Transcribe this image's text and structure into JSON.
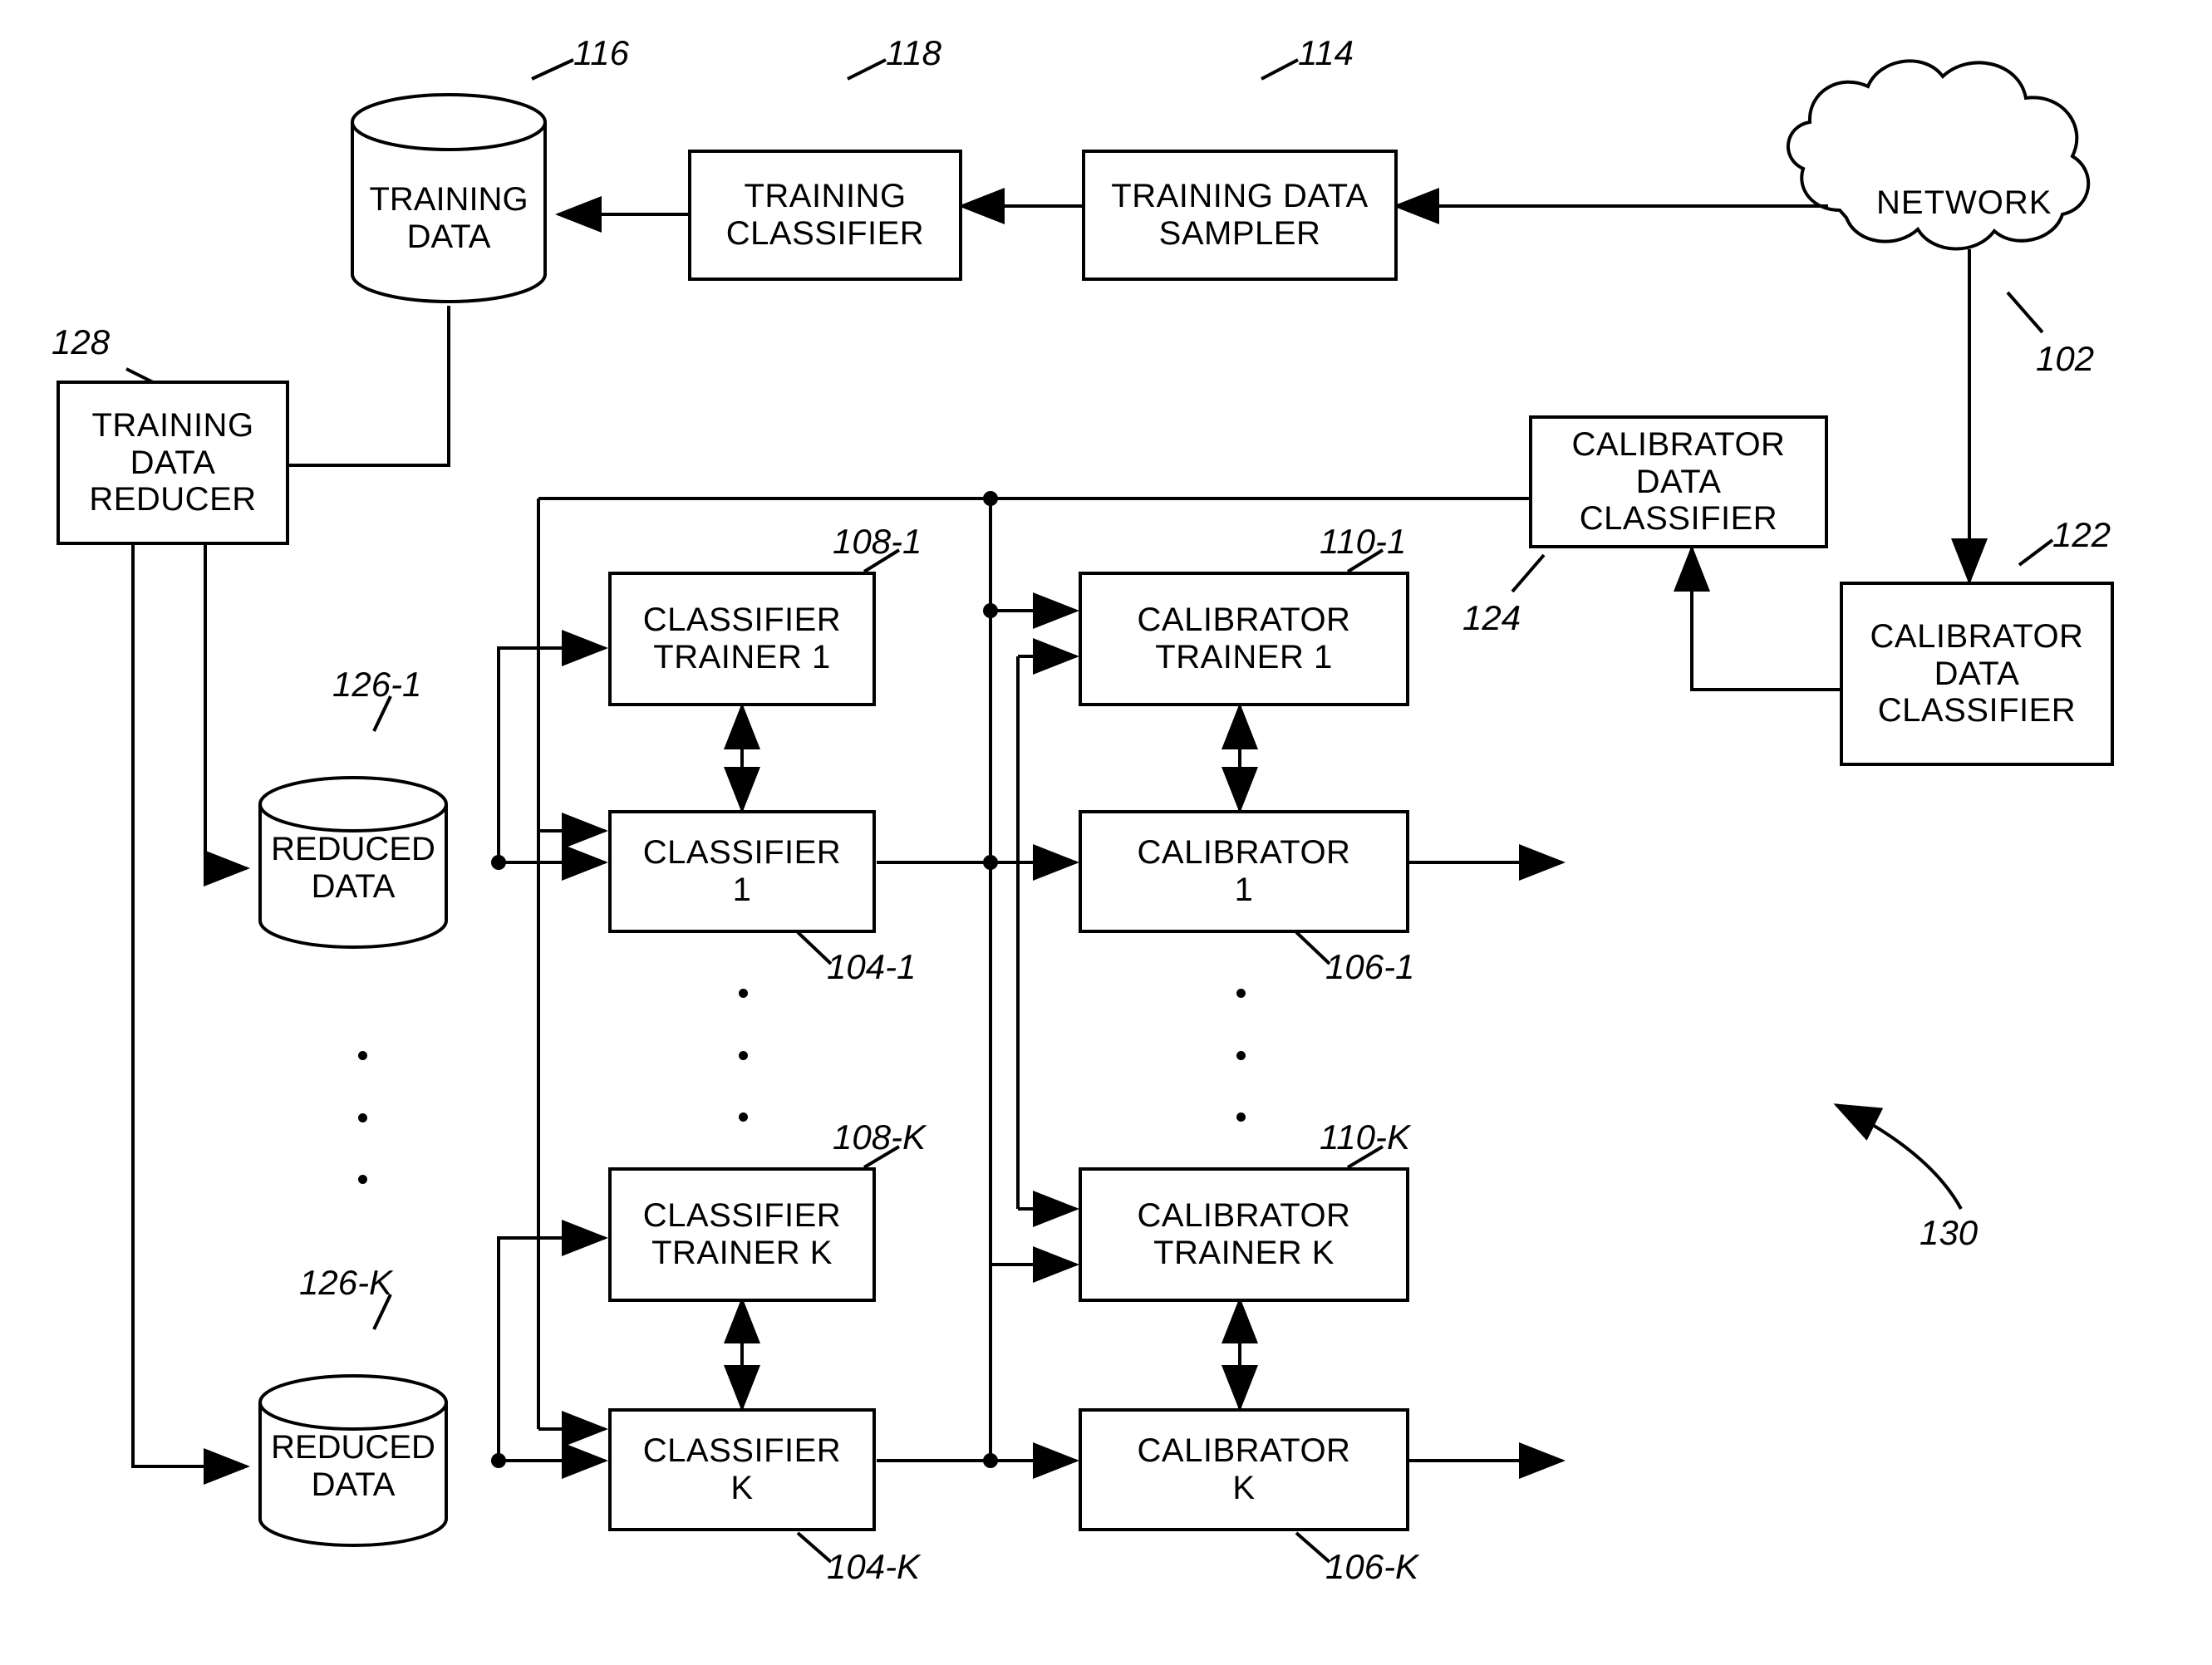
{
  "figure": {
    "title": "Classifier and calibrator training block diagram",
    "overall_ref": "130"
  },
  "nodes": {
    "training_data_store": {
      "lines": [
        "TRAINING",
        "DATA"
      ],
      "ref": "116"
    },
    "training_classifier": {
      "lines": [
        "TRAINING",
        "CLASSIFIER"
      ],
      "ref": "118"
    },
    "training_data_sampler": {
      "lines": [
        "TRAINING  DATA",
        "SAMPLER"
      ],
      "ref": "114"
    },
    "network": {
      "lines": [
        "NETWORK"
      ],
      "ref": "102"
    },
    "training_data_reducer": {
      "lines": [
        "TRAINING",
        "DATA",
        "REDUCER"
      ],
      "ref": "128"
    },
    "calibrator_data_classifier_top": {
      "lines": [
        "CALIBRATOR",
        "DATA",
        "CLASSIFIER"
      ],
      "ref": "124"
    },
    "calibrator_data_classifier_right": {
      "lines": [
        "CALIBRATOR",
        "DATA",
        "CLASSIFIER"
      ],
      "ref": "122"
    },
    "reduced_data_1": {
      "lines": [
        "REDUCED",
        "DATA"
      ],
      "ref": "126-1"
    },
    "reduced_data_k": {
      "lines": [
        "REDUCED",
        "DATA"
      ],
      "ref": "126-K"
    },
    "classifier_trainer_1": {
      "lines": [
        "CLASSIFIER",
        "TRAINER 1"
      ],
      "ref": "108-1"
    },
    "classifier_trainer_k": {
      "lines": [
        "CLASSIFIER",
        "TRAINER K"
      ],
      "ref": "108-K"
    },
    "classifier_1": {
      "lines": [
        "CLASSIFIER",
        "1"
      ],
      "ref": "104-1"
    },
    "classifier_k": {
      "lines": [
        "CLASSIFIER",
        "K"
      ],
      "ref": "104-K"
    },
    "calibrator_trainer_1": {
      "lines": [
        "CALIBRATOR",
        "TRAINER 1"
      ],
      "ref": "110-1"
    },
    "calibrator_trainer_k": {
      "lines": [
        "CALIBRATOR",
        "TRAINER K"
      ],
      "ref": "110-K"
    },
    "calibrator_1": {
      "lines": [
        "CALIBRATOR",
        "1"
      ],
      "ref": "106-1"
    },
    "calibrator_k": {
      "lines": [
        "CALIBRATOR",
        "K"
      ],
      "ref": "106-K"
    }
  },
  "labels": {
    "ref_116": "116",
    "ref_118": "118",
    "ref_114": "114",
    "ref_102": "102",
    "ref_122": "122",
    "ref_124": "124",
    "ref_128": "128",
    "ref_126_1": "126-1",
    "ref_126_k": "126-K",
    "ref_108_1": "108-1",
    "ref_108_k": "108-K",
    "ref_104_1": "104-1",
    "ref_104_k": "104-K",
    "ref_110_1": "110-1",
    "ref_110_k": "110-K",
    "ref_106_1": "106-1",
    "ref_106_k": "106-K",
    "ref_130": "130"
  },
  "text": {
    "training_l1": "TRAINING",
    "training_l2": "DATA",
    "training_classifier_l1": "TRAINING",
    "training_classifier_l2": "CLASSIFIER",
    "sampler_l1": "TRAINING  DATA",
    "sampler_l2": "SAMPLER",
    "network": "NETWORK",
    "reducer_l1": "TRAINING",
    "reducer_l2": "DATA",
    "reducer_l3": "REDUCER",
    "cdc_top_l1": "CALIBRATOR",
    "cdc_top_l2": "DATA",
    "cdc_top_l3": "CLASSIFIER",
    "cdc_right_l1": "CALIBRATOR",
    "cdc_right_l2": "DATA",
    "cdc_right_l3": "CLASSIFIER",
    "reduced_l1": "REDUCED",
    "reduced_l2": "DATA",
    "classifier_trainer_1_l1": "CLASSIFIER",
    "classifier_trainer_1_l2": "TRAINER 1",
    "classifier_trainer_k_l1": "CLASSIFIER",
    "classifier_trainer_k_l2": "TRAINER K",
    "classifier_1_l1": "CLASSIFIER",
    "classifier_1_l2": "1",
    "classifier_k_l1": "CLASSIFIER",
    "classifier_k_l2": "K",
    "calibrator_trainer_1_l1": "CALIBRATOR",
    "calibrator_trainer_1_l2": "TRAINER 1",
    "calibrator_trainer_k_l1": "CALIBRATOR",
    "calibrator_trainer_k_l2": "TRAINER K",
    "calibrator_1_l1": "CALIBRATOR",
    "calibrator_1_l2": "1",
    "calibrator_k_l1": "CALIBRATOR",
    "calibrator_k_l2": "K"
  },
  "colors": {
    "stroke": "#000000",
    "background": "#ffffff"
  }
}
